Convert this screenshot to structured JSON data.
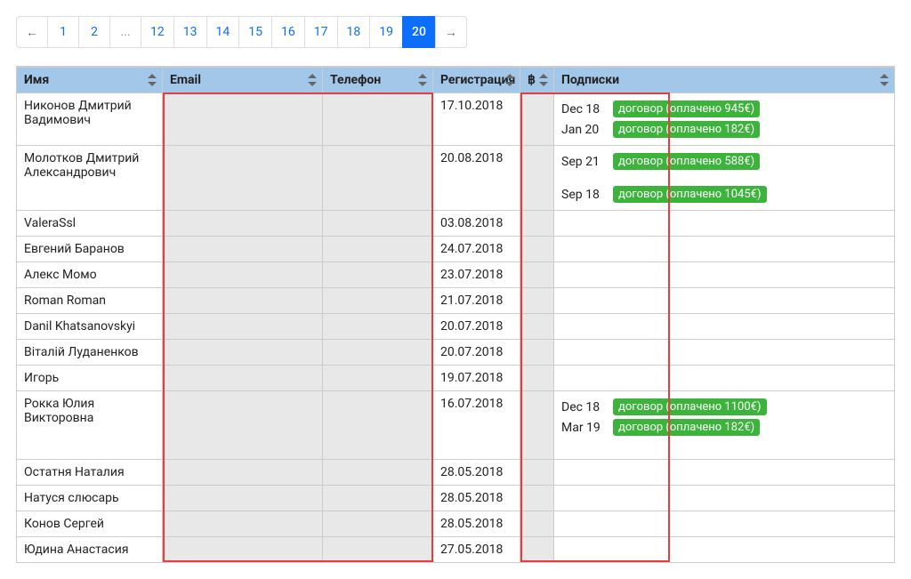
{
  "pagination": {
    "prev_label": "←",
    "next_label": "→",
    "pages": [
      "1",
      "2",
      "...",
      "12",
      "13",
      "14",
      "15",
      "16",
      "17",
      "18",
      "19",
      "20"
    ],
    "active": "20"
  },
  "columns": {
    "name": "Имя",
    "email": "Email",
    "phone": "Телефон",
    "registration": "Регистрация",
    "currency": "฿",
    "subscriptions": "Подписки"
  },
  "rows": [
    {
      "name": "Никонов Дмитрий Вадимович",
      "registration": "17.10.2018",
      "subscriptions": [
        {
          "date": "Dec 18",
          "badge": "договор (оплачено 945€)"
        },
        {
          "date": "Jan 20",
          "badge": "договор (оплачено 182€)"
        }
      ]
    },
    {
      "name": "Молотков Дмитрий Александрович",
      "registration": "20.08.2018",
      "subscriptions": [
        {
          "date": "Sep 21",
          "badge": "договор (оплачено 588€)"
        },
        {
          "date": "Sep 18",
          "badge": "договор (оплачено 1045€)"
        }
      ]
    },
    {
      "name": "ValeraSsl",
      "registration": "03.08.2018",
      "subscriptions": []
    },
    {
      "name": "Евгений Баранов",
      "registration": "24.07.2018",
      "subscriptions": []
    },
    {
      "name": "Алекс Момо",
      "registration": "23.07.2018",
      "subscriptions": []
    },
    {
      "name": "Roman Roman",
      "registration": "21.07.2018",
      "subscriptions": []
    },
    {
      "name": "Danil Khatsanovskyi",
      "registration": "20.07.2018",
      "subscriptions": []
    },
    {
      "name": "Віталій Луданенков",
      "registration": "20.07.2018",
      "subscriptions": []
    },
    {
      "name": "Игорь",
      "registration": "19.07.2018",
      "subscriptions": []
    },
    {
      "name": "Рокка Юлия Викторовна",
      "registration": "16.07.2018",
      "subscriptions": [
        {
          "date": "Dec 18",
          "badge": "договор (оплачено 1100€)"
        },
        {
          "date": "Mar 19",
          "badge": "договор (оплачено 182€)"
        }
      ]
    },
    {
      "name": "Остатня Наталия",
      "registration": "28.05.2018",
      "subscriptions": []
    },
    {
      "name": "Натуся слюсарь",
      "registration": "28.05.2018",
      "subscriptions": []
    },
    {
      "name": "Конов Сергей",
      "registration": "28.05.2018",
      "subscriptions": []
    },
    {
      "name": "Юдина Анастасия",
      "registration": "27.05.2018",
      "subscriptions": []
    }
  ]
}
